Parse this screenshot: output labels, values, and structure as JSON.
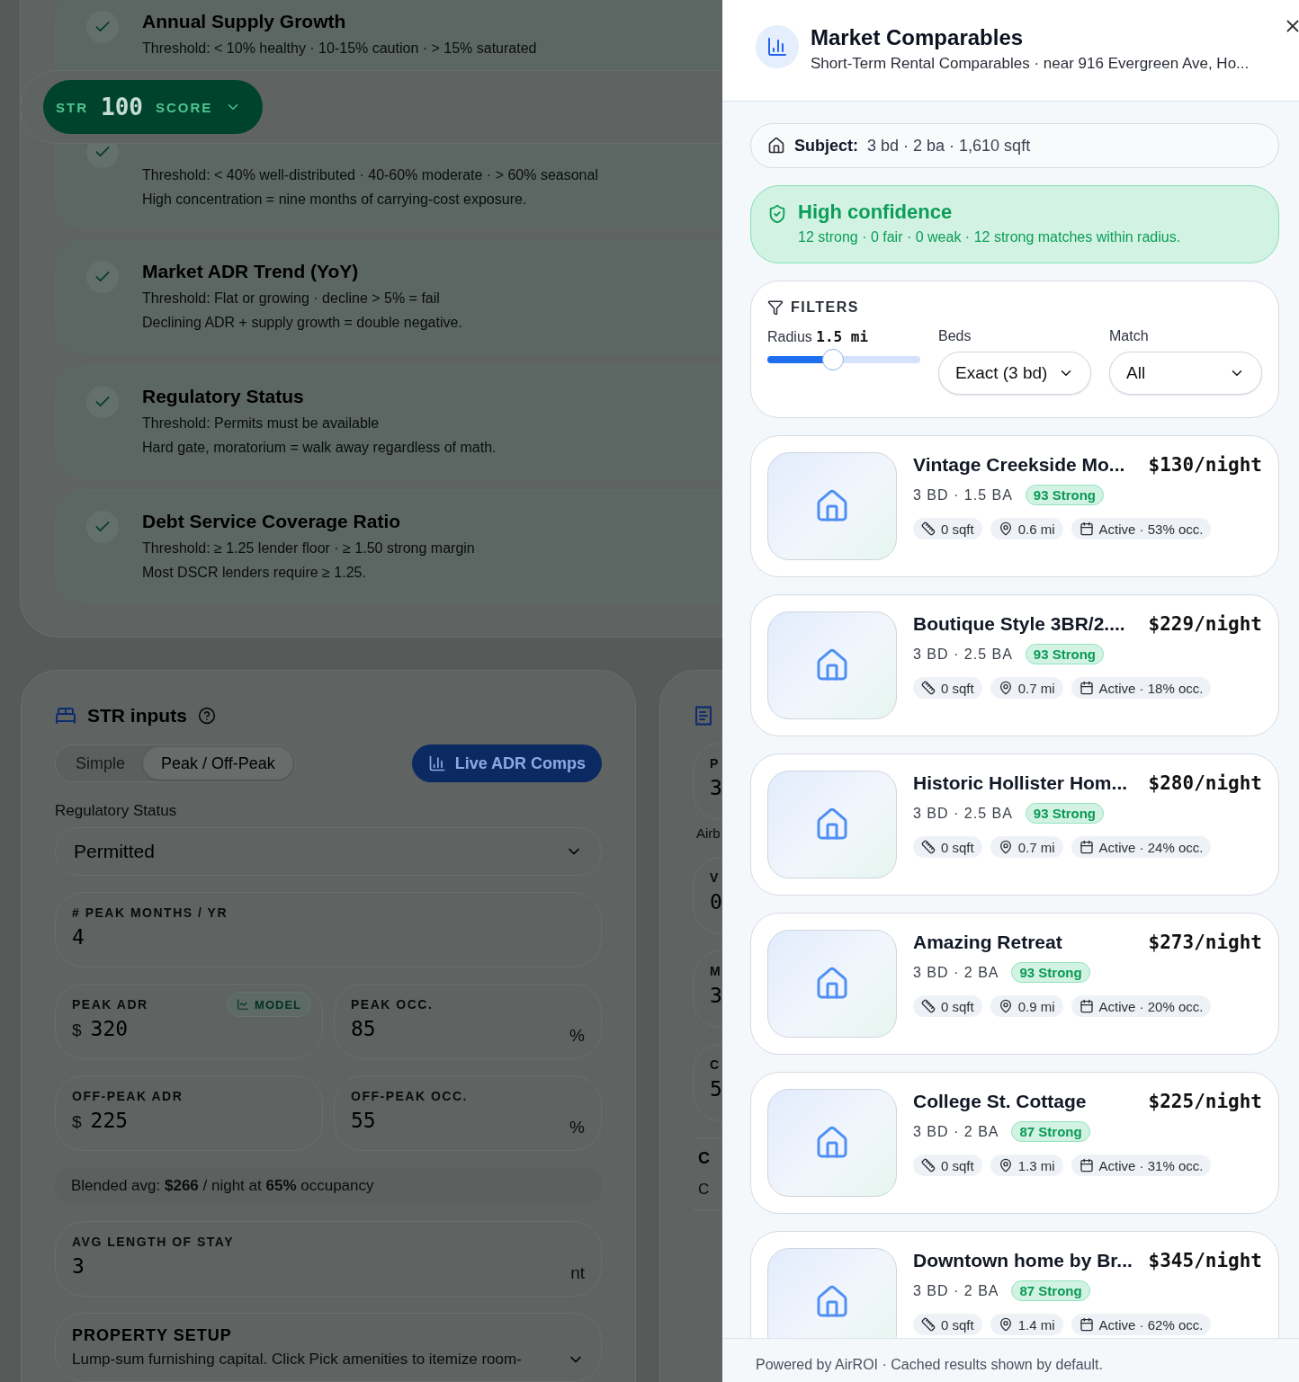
{
  "background_page": {
    "score_pill": {
      "prefix": "STR",
      "value": "100",
      "suffix": "SCORE"
    },
    "criteria": [
      {
        "title": "Annual Supply Growth",
        "threshold": "Threshold: < 10% healthy · 10-15% caution · > 15% saturated"
      },
      {
        "threshold": "Threshold: < 40% well-distributed · 40-60% moderate · > 60% seasonal",
        "note": "High concentration = nine months of carrying-cost exposure."
      },
      {
        "title": "Market ADR Trend (YoY)",
        "threshold": "Threshold: Flat or growing · decline > 5% = fail",
        "note": "Declining ADR + supply growth = double negative."
      },
      {
        "title": "Regulatory Status",
        "threshold": "Threshold: Permits must be available",
        "note": "Hard gate, moratorium = walk away regardless of math."
      },
      {
        "title": "Debt Service Coverage Ratio",
        "threshold": "Threshold: ≥ 1.25 lender floor · ≥ 1.50 strong margin",
        "note": "Most DSCR lenders require ≥ 1.25."
      }
    ],
    "str_inputs": {
      "title": "STR inputs",
      "mode_tabs": [
        {
          "label": "Simple",
          "selected": false
        },
        {
          "label": "Peak / Off-Peak",
          "selected": true
        }
      ],
      "comps_button": "Live ADR Comps",
      "regulatory_label": "Regulatory Status",
      "regulatory_value": "Permitted",
      "peak_months": {
        "label": "# PEAK MONTHS / YR",
        "value": "4"
      },
      "rate_fields": [
        {
          "label": "PEAK ADR",
          "prefix": "$",
          "value": "320",
          "badge": "MODEL"
        },
        {
          "label": "PEAK OCC.",
          "value": "85",
          "suffix": "%"
        },
        {
          "label": "OFF-PEAK ADR",
          "prefix": "$",
          "value": "225"
        },
        {
          "label": "OFF-PEAK OCC.",
          "value": "55",
          "suffix": "%"
        }
      ],
      "blended": "Blended avg: **$266** / night at **65%** occupancy",
      "stay": {
        "label": "AVG LENGTH OF STAY",
        "value": "3",
        "suffix": "nt"
      },
      "property_setup": {
        "title": "PROPERTY SETUP",
        "description": "Lump-sum furnishing capital. Click Pick amenities to itemize room-"
      }
    },
    "side_card": {
      "fields": [
        {
          "label": "P",
          "value": "3",
          "note": "Airb"
        },
        {
          "label": "V",
          "value": "0"
        },
        {
          "label": "M",
          "value": "3"
        },
        {
          "label": "C",
          "value": "5"
        }
      ],
      "section": {
        "title": "C",
        "subtitle": "C"
      }
    }
  },
  "drawer": {
    "title": "Market Comparables",
    "subtitle": "Short-Term Rental Comparables · near 916 Evergreen Ave, Ho...",
    "subject": {
      "label": "Subject:",
      "value": "3 bd · 2 ba · 1,610 sqft"
    },
    "confidence": {
      "title": "High confidence",
      "detail": "12 strong · 0 fair · 0 weak · 12 strong matches within radius."
    },
    "filters": {
      "title": "FILTERS",
      "radius_label": "Radius",
      "radius_value": "1.5 mi",
      "radius": {
        "level": 0.42
      },
      "beds_label": "Beds",
      "beds_value": "Exact (3 bd)",
      "match_label": "Match",
      "match_value": "All"
    },
    "comps": [
      {
        "title": "Vintage Creekside Mo...",
        "price": "$130/night",
        "rooms": "3 BD · 1.5 BA",
        "score": "93 Strong",
        "sqft": "0 sqft",
        "distance": "0.6 mi",
        "status": "Active · 53% occ."
      },
      {
        "title": "Boutique Style 3BR/2....",
        "price": "$229/night",
        "rooms": "3 BD · 2.5 BA",
        "score": "93 Strong",
        "sqft": "0 sqft",
        "distance": "0.7 mi",
        "status": "Active · 18% occ."
      },
      {
        "title": "Historic Hollister Hom...",
        "price": "$280/night",
        "rooms": "3 BD · 2.5 BA",
        "score": "93 Strong",
        "sqft": "0 sqft",
        "distance": "0.7 mi",
        "status": "Active · 24% occ."
      },
      {
        "title": "Amazing Retreat",
        "price": "$273/night",
        "rooms": "3 BD · 2 BA",
        "score": "93 Strong",
        "sqft": "0 sqft",
        "distance": "0.9 mi",
        "status": "Active · 20% occ."
      },
      {
        "title": "College St. Cottage",
        "price": "$225/night",
        "rooms": "3 BD · 2 BA",
        "score": "87 Strong",
        "sqft": "0 sqft",
        "distance": "1.3 mi",
        "status": "Active · 31% occ."
      },
      {
        "title": "Downtown home by Br...",
        "price": "$345/night",
        "rooms": "3 BD · 2 BA",
        "score": "87 Strong",
        "sqft": "0 sqft",
        "distance": "1.4 mi",
        "status": "Active · 62% occ."
      }
    ],
    "footer": "Powered by AirROI · Cached results shown by default."
  }
}
